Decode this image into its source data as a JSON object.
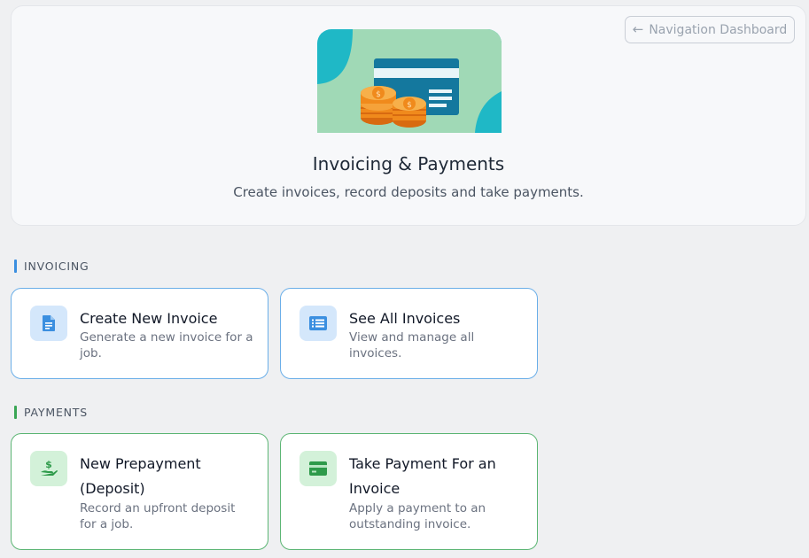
{
  "header": {
    "nav_button_label": "Navigation Dashboard",
    "title": "Invoicing & Payments",
    "subtitle": "Create invoices, record deposits and take payments."
  },
  "sections": {
    "invoicing": {
      "label": "INVOICING",
      "accent": "#3b8fe0",
      "cards": [
        {
          "title": "Create New Invoice",
          "description": "Generate a new invoice for a job.",
          "icon": "document-icon"
        },
        {
          "title": "See All Invoices",
          "description": "View and manage all invoices.",
          "icon": "list-icon"
        }
      ]
    },
    "payments": {
      "label": "PAYMENTS",
      "accent": "#3aa655",
      "cards": [
        {
          "title": "New Prepayment (Deposit)",
          "description": "Record an upfront deposit for a job.",
          "icon": "hand-dollar-icon"
        },
        {
          "title": "Take Payment For an Invoice",
          "description": "Apply a payment to an outstanding invoice.",
          "icon": "credit-card-icon"
        }
      ]
    }
  },
  "colors": {
    "background": "#eff0f2",
    "invoice_card_border": "#6aaee8",
    "payment_card_border": "#5bb573",
    "illustration_teal": "#1fb8c6",
    "illustration_mint": "#9fd9b8",
    "illustration_card": "#1479a0",
    "illustration_coin": "#f08a1c"
  }
}
